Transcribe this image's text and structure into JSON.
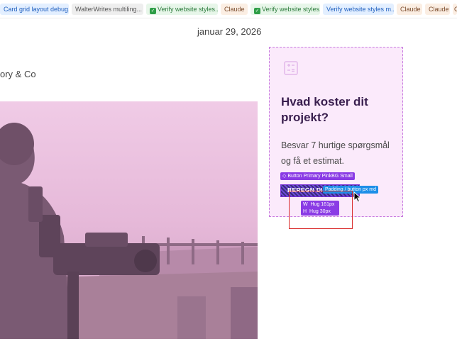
{
  "tabs": [
    {
      "label": "Card grid layout debug...",
      "style": "blue",
      "check": false
    },
    {
      "label": "WalterWrites multiling...",
      "style": "gray",
      "check": false
    },
    {
      "label": "Verify website styles...",
      "style": "green",
      "check": true
    },
    {
      "label": "Claude",
      "style": "claude",
      "check": false
    },
    {
      "label": "Verify website styles...",
      "style": "green",
      "check": true
    },
    {
      "label": "Verify website styles m...",
      "style": "blue",
      "check": false
    },
    {
      "label": "Claude",
      "style": "claude",
      "check": false
    },
    {
      "label": "Claude",
      "style": "claude",
      "check": false
    },
    {
      "label": "C",
      "style": "claude",
      "check": false
    }
  ],
  "article": {
    "date": "januar 29, 2026",
    "author_fragment": "ory & Co"
  },
  "card": {
    "icon": "calculator-icon",
    "title": "Hvad koster dit projekt?",
    "description": "Besvar 7 hurtige spørgsmål og få et estimat."
  },
  "inspector": {
    "component_label": "◇ Button Primary PinkBG Small",
    "button_text": "BEREGN DI",
    "padding_label": "Padding / button px md",
    "width_label": "W",
    "width_value": "Hug 161px",
    "height_label": "H",
    "height_value": "Hug 30px"
  },
  "colors": {
    "card_bg": "#fbeafb",
    "inspector_purple": "#8a3be5",
    "inspector_blue": "#1d8fe8",
    "highlight_red": "#d92b2b"
  }
}
